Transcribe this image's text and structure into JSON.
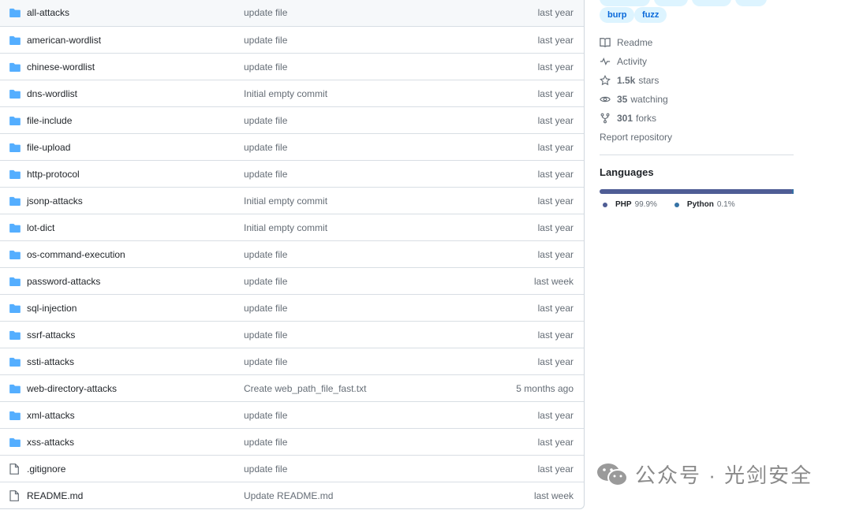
{
  "files": [
    {
      "type": "dir",
      "name": "all-attacks",
      "message": "update file",
      "date": "last year"
    },
    {
      "type": "dir",
      "name": "american-wordlist",
      "message": "update file",
      "date": "last year"
    },
    {
      "type": "dir",
      "name": "chinese-wordlist",
      "message": "update file",
      "date": "last year"
    },
    {
      "type": "dir",
      "name": "dns-wordlist",
      "message": "Initial empty commit",
      "date": "last year"
    },
    {
      "type": "dir",
      "name": "file-include",
      "message": "update file",
      "date": "last year"
    },
    {
      "type": "dir",
      "name": "file-upload",
      "message": "update file",
      "date": "last year"
    },
    {
      "type": "dir",
      "name": "http-protocol",
      "message": "update file",
      "date": "last year"
    },
    {
      "type": "dir",
      "name": "jsonp-attacks",
      "message": "Initial empty commit",
      "date": "last year"
    },
    {
      "type": "dir",
      "name": "lot-dict",
      "message": "Initial empty commit",
      "date": "last year"
    },
    {
      "type": "dir",
      "name": "os-command-execution",
      "message": "update file",
      "date": "last year"
    },
    {
      "type": "dir",
      "name": "password-attacks",
      "message": "update file",
      "date": "last week"
    },
    {
      "type": "dir",
      "name": "sql-injection",
      "message": "update file",
      "date": "last year"
    },
    {
      "type": "dir",
      "name": "ssrf-attacks",
      "message": "update file",
      "date": "last year"
    },
    {
      "type": "dir",
      "name": "ssti-attacks",
      "message": "update file",
      "date": "last year"
    },
    {
      "type": "dir",
      "name": "web-directory-attacks",
      "message": "Create web_path_file_fast.txt",
      "date": "5 months ago"
    },
    {
      "type": "dir",
      "name": "xml-attacks",
      "message": "update file",
      "date": "last year"
    },
    {
      "type": "dir",
      "name": "xss-attacks",
      "message": "update file",
      "date": "last year"
    },
    {
      "type": "file",
      "name": ".gitignore",
      "message": "update file",
      "date": "last year"
    },
    {
      "type": "file",
      "name": "README.md",
      "message": "Update README.md",
      "date": "last week"
    }
  ],
  "sidebar": {
    "tags": [
      "burp",
      "fuzz"
    ],
    "readme": "Readme",
    "activity": "Activity",
    "stars_count": "1.5k",
    "stars_label": "stars",
    "watching_count": "35",
    "watching_label": "watching",
    "forks_count": "301",
    "forks_label": "forks",
    "report": "Report repository",
    "languages_title": "Languages",
    "languages": [
      {
        "name": "PHP",
        "percent": "99.9%",
        "color": "#4F5D95"
      },
      {
        "name": "Python",
        "percent": "0.1%",
        "color": "#3572A5"
      }
    ]
  },
  "watermark": "公众号 · 光剑安全",
  "colors": {
    "folder": "#54aeff",
    "link": "#0969da",
    "tag_bg": "#ddf4ff"
  }
}
